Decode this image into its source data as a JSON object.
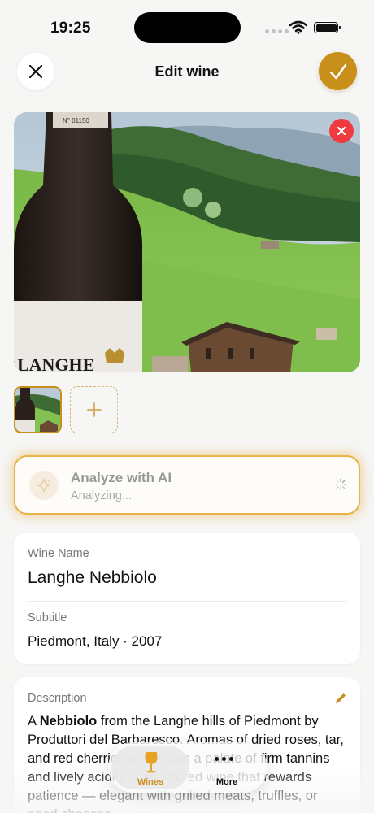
{
  "status": {
    "time": "19:25",
    "icons": [
      "signal-icon",
      "wifi-icon",
      "battery-icon"
    ]
  },
  "header": {
    "title": "Edit wine",
    "close_icon": "close-icon",
    "save_icon": "checkmark-icon"
  },
  "photos": {
    "main_remove_icon": "remove-icon",
    "thumbnail_count": 1,
    "add_icon": "plus-icon",
    "bottle_label_text": "LANGHE",
    "bottle_neck_text": "N° 01150"
  },
  "analyze": {
    "title": "Analyze with AI",
    "status": "Analyzing...",
    "icon": "sparkle-icon"
  },
  "fields": {
    "name_label": "Wine Name",
    "name_value": "Langhe Nebbiolo",
    "subtitle_label": "Subtitle",
    "subtitle_value": "Piedmont, Italy · 2007"
  },
  "description": {
    "label": "Description",
    "text_prefix": "A ",
    "text_bold": "Nebbiolo",
    "text_rest": " from the Langhe hills of Piedmont by Produttori del Barbaresco. Aromas of dried roses, tar, and red cherries unfold into a palate of firm tannins and lively acidity. A structured wine that rewards patience — elegant with grilled meats, truffles, or aged cheeses."
  },
  "tabs": [
    {
      "label": "Wines",
      "icon": "wine-glass-icon",
      "active": true
    },
    {
      "label": "More",
      "icon": "more-icon",
      "active": false
    }
  ],
  "colors": {
    "accent": "#c8901b",
    "remove": "#ef3b3f",
    "analyze_border": "#e8b348"
  }
}
